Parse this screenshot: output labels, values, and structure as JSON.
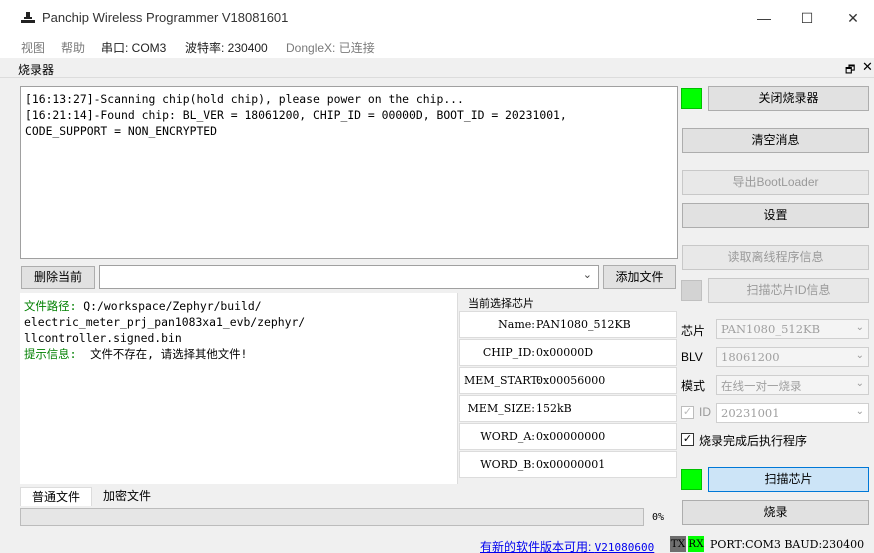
{
  "window": {
    "title": "Panchip Wireless Programmer V18081601",
    "min_glyph": "—",
    "max_glyph": "☐",
    "close_glyph": "✕"
  },
  "menu": {
    "view": "视图",
    "help": "帮助",
    "port": "串口: COM3",
    "baud": "波特率: 230400",
    "dongle": "DongleX: 已连接"
  },
  "dock": {
    "title": "烧录器",
    "float_glyph": "🗗",
    "close_glyph": "✕"
  },
  "log": {
    "text": "[16:13:27]-Scanning chip(hold chip), please power on the chip...\n[16:21:14]-Found chip: BL_VER = 18061200, CHIP_ID = 00000D, BOOT_ID = 20231001,\nCODE_SUPPORT = NON_ENCRYPTED"
  },
  "file_row": {
    "delete_label": "删除当前",
    "add_label": "添加文件",
    "combo_value": "",
    "combo_arrow": "⌄"
  },
  "info": {
    "path_label": "文件路径:",
    "path_value": " Q:/workspace/Zephyr/build/\nelectric_meter_prj_pan1083xa1_evb/zephyr/\nllcontroller.signed.bin",
    "tip_label": "提示信息:",
    "tip_value": "  文件不存在, 请选择其他文件!"
  },
  "chip_panel": {
    "legend": "当前选择芯片",
    "rows": [
      {
        "key": "Name:",
        "value": "PAN1080_512KB"
      },
      {
        "key": "CHIP_ID:",
        "value": "0x00000D"
      },
      {
        "key": "MEM_START:",
        "value": "0x00056000"
      },
      {
        "key": "MEM_SIZE:",
        "value": "152kB"
      },
      {
        "key": "WORD_A:",
        "value": "0x00000000"
      },
      {
        "key": "WORD_B:",
        "value": "0x00000001"
      }
    ]
  },
  "tabs": {
    "normal": "普通文件",
    "encrypted": "加密文件"
  },
  "progress": {
    "percent": 0,
    "text": "0%"
  },
  "side": {
    "close_programmer": "关闭烧录器",
    "clear_messages": "清空消息",
    "export_bootloader": "导出BootLoader",
    "settings": "设置",
    "read_offline": "读取离线程序信息",
    "scan_chip_id": "扫描芯片ID信息",
    "chip_label": "芯片",
    "chip_value": "PAN1080_512KB",
    "blv_label": "BLV",
    "blv_value": "18061200",
    "mode_label": "模式",
    "mode_value": "在线一对一烧录",
    "id_label": "ID",
    "id_value": "20231001",
    "run_after_label": "烧录完成后执行程序",
    "scan_chip": "扫描芯片",
    "program": "烧录",
    "check_glyph": "✓",
    "combo_arrow": "⌄"
  },
  "status": {
    "update_text": "有新的软件版本可用: ",
    "update_version": "V21080600",
    "tx": "TX",
    "rx": "RX",
    "port_info": "PORT:COM3 BAUD:230400"
  },
  "colors": {
    "led_on": "#00ff00",
    "accent_blue": "#cce4f7",
    "log_green": "#008000",
    "link": "#0000ee"
  }
}
